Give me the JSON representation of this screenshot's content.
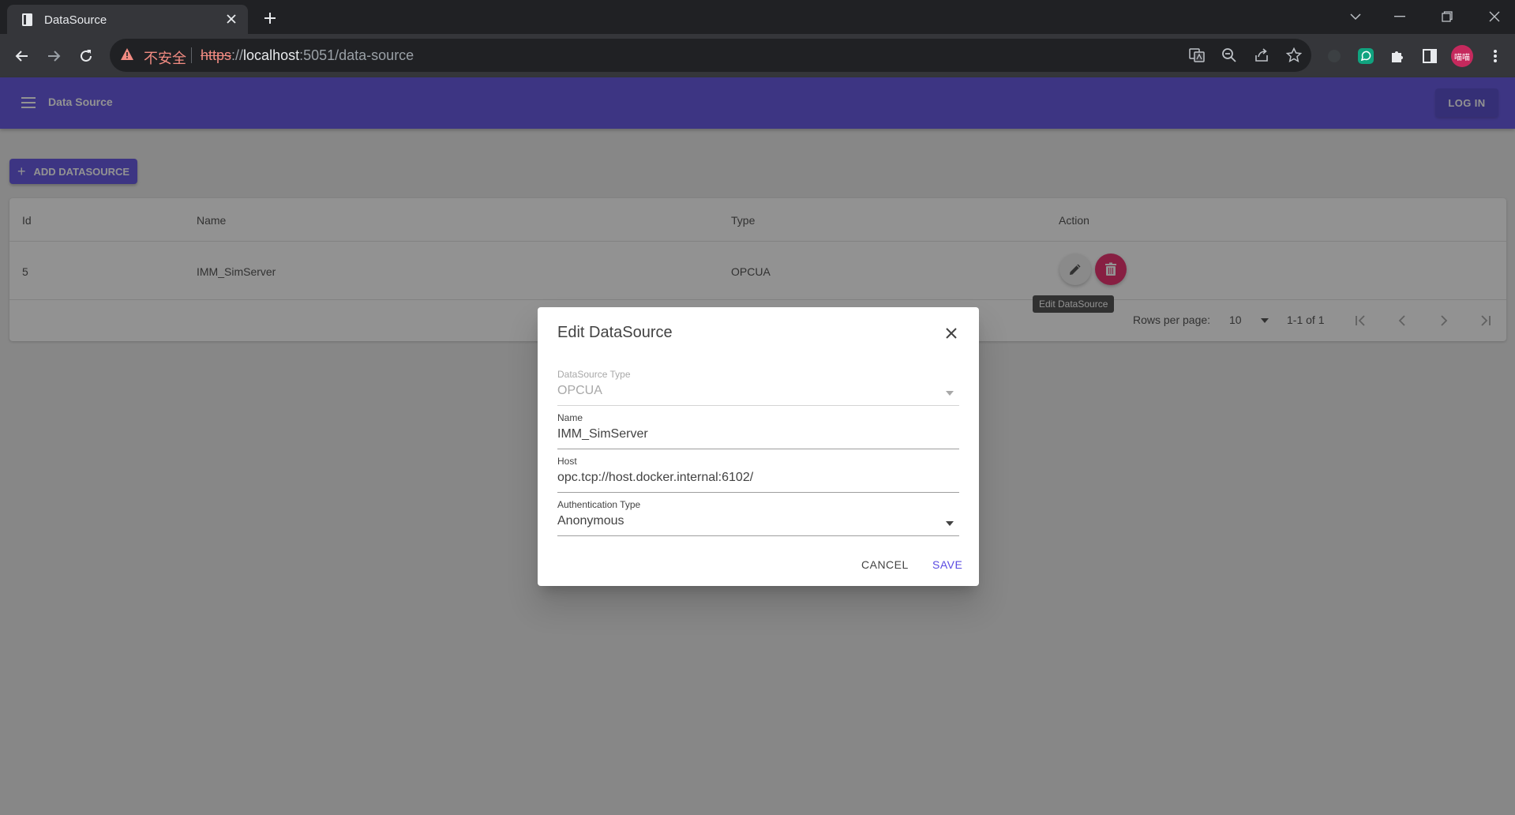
{
  "browser": {
    "tab_title": "DataSource",
    "security_label": "不安全",
    "url_scheme": "https",
    "url_separator": "://",
    "url_host": "localhost",
    "url_rest": ":5051/data-source",
    "profile_label": "喵喵",
    "profile_color": "#c5295d",
    "icons": [
      "tab-favicon-icon",
      "close-icon",
      "plus-icon",
      "chevron-down-icon",
      "minimize-icon",
      "restore-icon",
      "back-arrow-icon",
      "forward-arrow-icon",
      "reload-icon",
      "warning-icon",
      "translate-icon",
      "zoom-icon",
      "share-icon",
      "star-icon",
      "extension-icon",
      "puzzle-icon",
      "sidebar-icon",
      "kebab-menu-icon"
    ]
  },
  "app": {
    "title": "Data Source",
    "login_label": "LOG IN",
    "add_button_label": "ADD DATASOURCE",
    "accent_color": "#594ae2",
    "delete_color": "#e91e63"
  },
  "table": {
    "headers": [
      "Id",
      "Name",
      "Type",
      "Action"
    ],
    "rows": [
      {
        "id": "5",
        "name": "IMM_SimServer",
        "type": "OPCUA"
      }
    ],
    "tooltip": "Edit DataSource",
    "rows_per_page_label": "Rows per page:",
    "rows_per_page_value": "10",
    "range_text": "1-1 of 1"
  },
  "dialog": {
    "title": "Edit DataSource",
    "fields": [
      {
        "label": "DataSource Type",
        "value": "OPCUA"
      },
      {
        "label": "Name",
        "value": "IMM_SimServer"
      },
      {
        "label": "Host",
        "value": "opc.tcp://host.docker.internal:6102/"
      },
      {
        "label": "Authentication Type",
        "value": "Anonymous"
      }
    ],
    "cancel_label": "CANCEL",
    "save_label": "SAVE"
  }
}
